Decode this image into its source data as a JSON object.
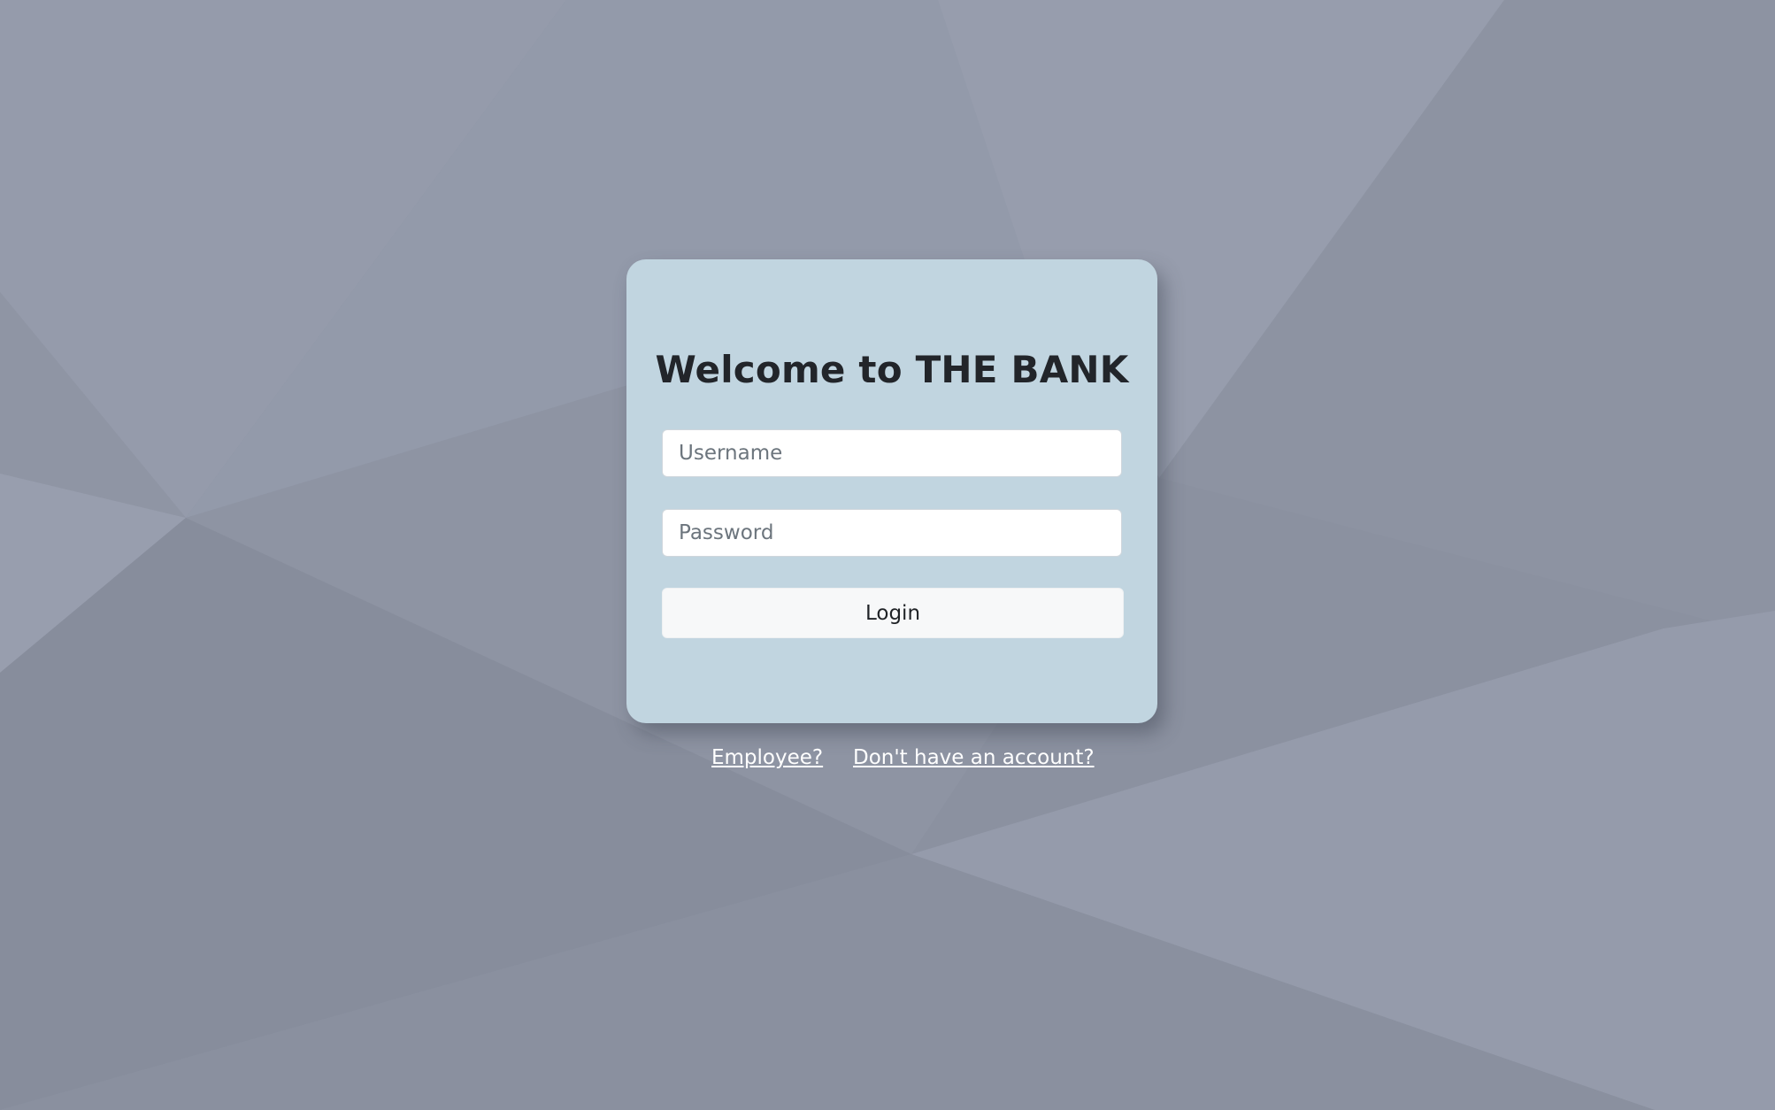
{
  "page": {
    "background_color": "#8e94a3",
    "card_color": "#c1d5e0"
  },
  "login_card": {
    "title": "Welcome to THE BANK",
    "username_placeholder": "Username",
    "password_placeholder": "Password",
    "login_label": "Login"
  },
  "links": {
    "employee_label": "Employee?",
    "signup_label": "Don't have an account?"
  }
}
